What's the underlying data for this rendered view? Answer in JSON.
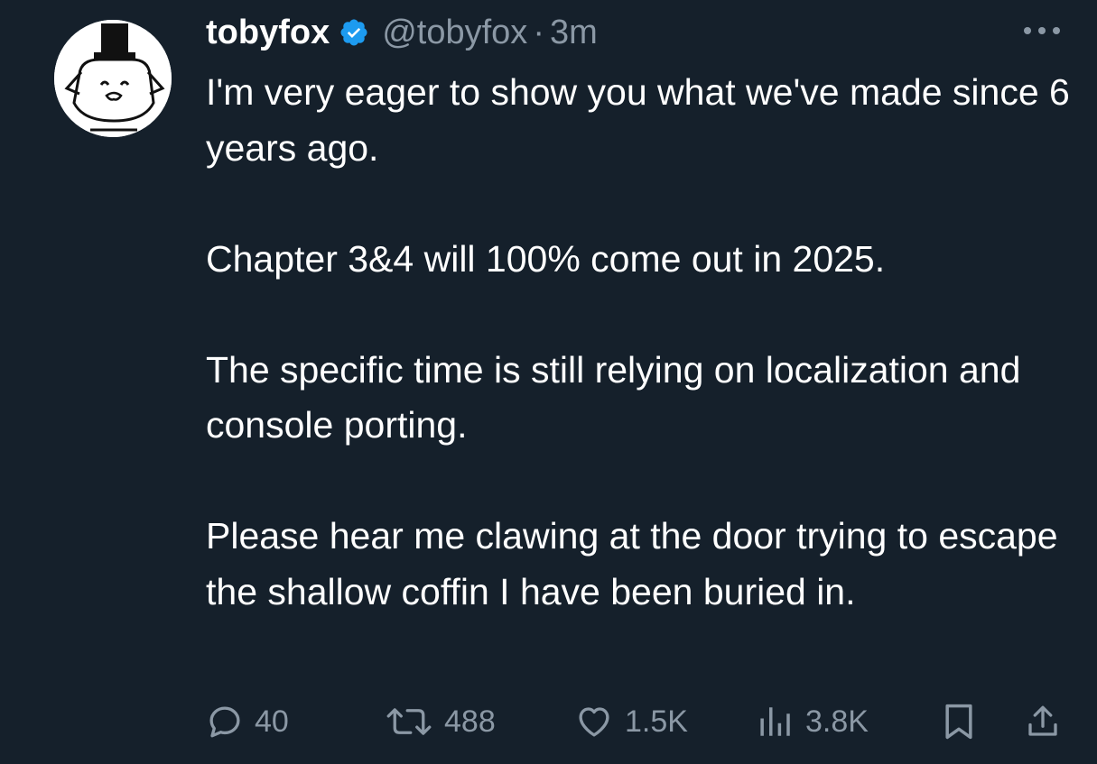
{
  "tweet": {
    "author": {
      "display_name": "tobyfox",
      "handle": "@tobyfox",
      "verified": true,
      "avatar_icon": "dog-with-top-hat-avatar"
    },
    "separator": "·",
    "timestamp": "3m",
    "more_icon": "more-horizontal-icon",
    "paragraphs": [
      "I'm very eager to show you what we've made since 6 years ago.",
      "Chapter 3&4 will 100% come out in 2025.",
      "The specific time is still relying on localization and console porting.",
      "Please hear me clawing at the door trying to escape the shallow coffin I have been buried in."
    ],
    "actions": {
      "reply": {
        "icon": "reply-icon",
        "count": "40"
      },
      "retweet": {
        "icon": "retweet-icon",
        "count": "488"
      },
      "like": {
        "icon": "heart-icon",
        "count": "1.5K"
      },
      "views": {
        "icon": "views-bar-chart-icon",
        "count": "3.8K"
      },
      "bookmark": {
        "icon": "bookmark-icon"
      },
      "share": {
        "icon": "share-icon"
      }
    }
  },
  "colors": {
    "background": "#15202b",
    "text_primary": "#ffffff",
    "text_secondary": "#8b98a5",
    "verified_blue": "#1d9bf0"
  }
}
